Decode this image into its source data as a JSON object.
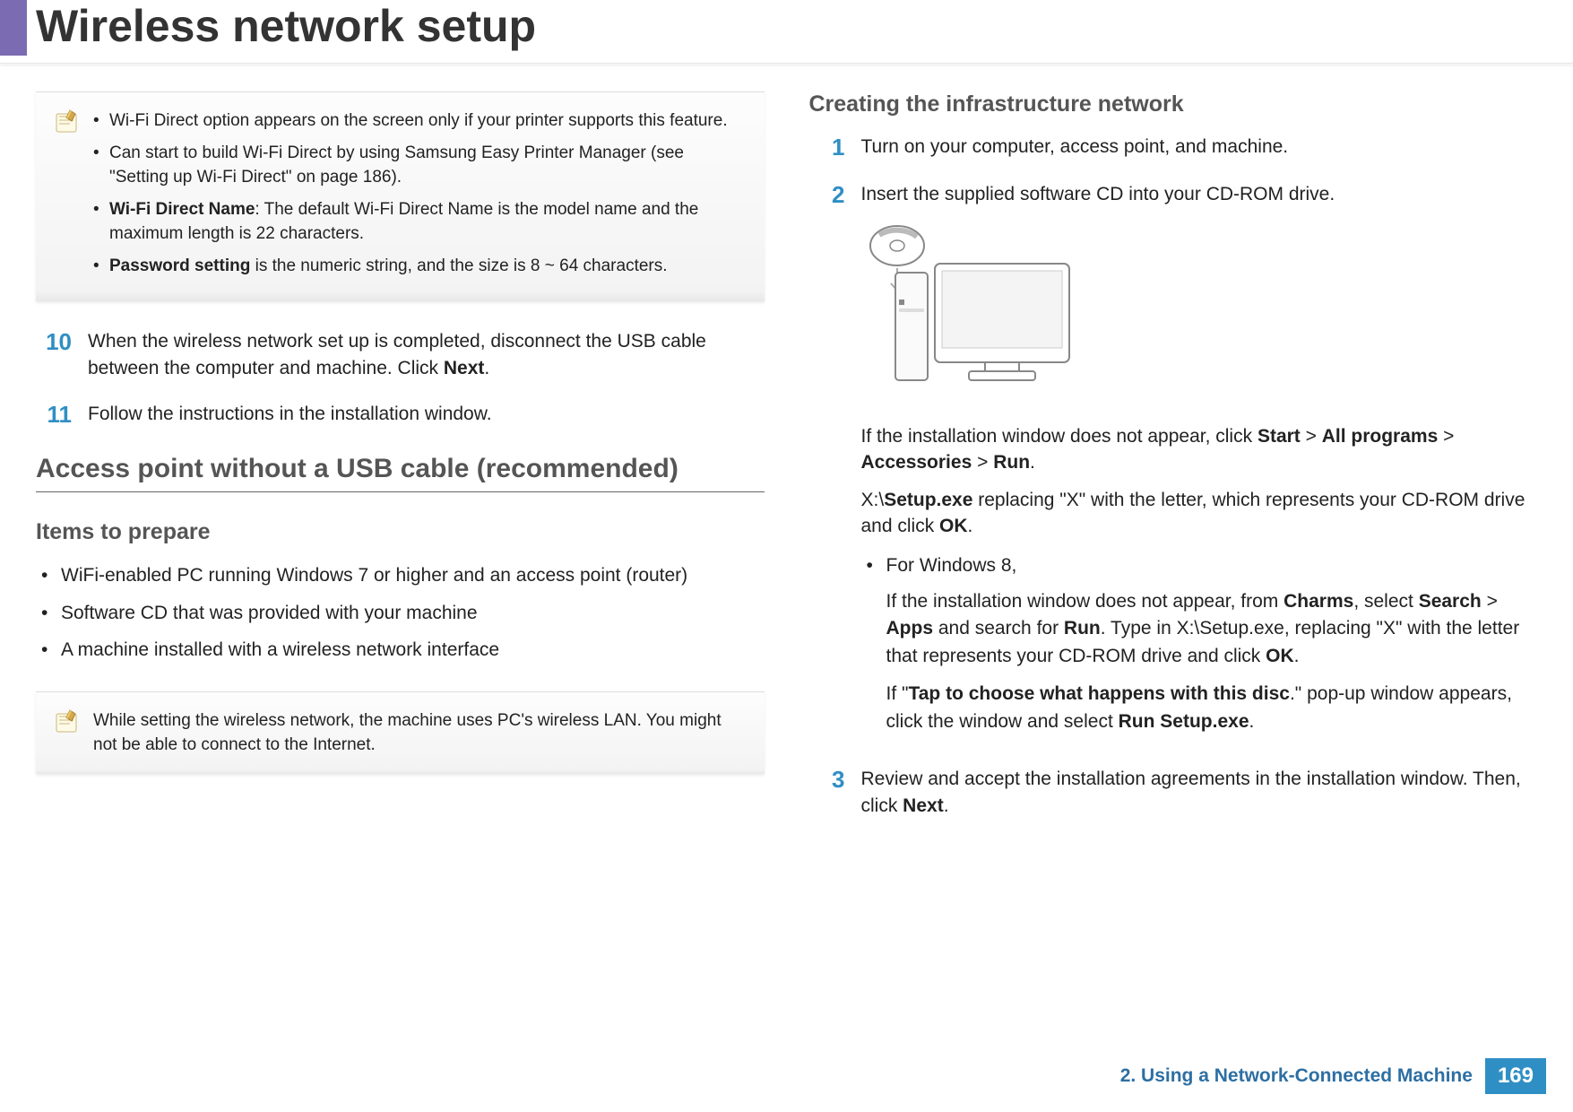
{
  "header": {
    "title": "Wireless network setup"
  },
  "left": {
    "note1": {
      "items": [
        "Wi-Fi Direct option appears on the screen only if your printer supports this feature.",
        "Can start to build Wi-Fi Direct by using Samsung Easy Printer Manager (see \"Setting up Wi-Fi Direct\" on page 186).",
        "<b>Wi-Fi Direct Name</b>: The default Wi-Fi Direct Name is the model name and the maximum length is 22 characters.",
        "<b>Password setting</b> is the numeric string, and the size is 8 ~ 64 characters."
      ]
    },
    "step10": {
      "num": "10",
      "text": "When the wireless network set up is completed, disconnect the USB cable between the computer and machine. Click <b>Next</b>."
    },
    "step11": {
      "num": "11",
      "text": "Follow the instructions in the installation window."
    },
    "h2": "Access point without a USB cable (recommended)",
    "h3": "Items to prepare",
    "prepare": [
      "WiFi-enabled PC running Windows 7 or higher and an access point (router)",
      "Software CD that was provided with your machine",
      "A machine installed with a wireless network interface"
    ],
    "note2": "While setting the wireless network, the machine uses PC's wireless LAN. You might not be able to connect to the Internet."
  },
  "right": {
    "h3": "Creating the infrastructure network",
    "step1": {
      "num": "1",
      "text": "Turn on your computer, access point, and machine."
    },
    "step2": {
      "num": "2",
      "p1": "Insert the supplied software CD into your CD-ROM drive.",
      "p2": "If the installation window does not appear, click <b>Start</b> > <b>All programs</b> > <b>Accessories</b> > <b>Run</b>.",
      "p3": " X:\\<b>Setup.exe</b> replacing \"X\" with the letter, which represents your CD-ROM drive and click <b>OK</b>.",
      "bullet": "For Windows 8,",
      "sub1": "If the installation window does not appear, from <b>Charms</b>, select <b>Search</b> > <b>Apps</b> and search for <b>Run</b>. Type in X:\\Setup.exe, replacing \"X\" with the letter that represents your CD-ROM drive and click <b>OK</b>.",
      "sub2": "If \"<b>Tap to choose what happens with this disc</b>.\" pop-up window appears, click the window and select <b>Run Setup.exe</b>."
    },
    "step3": {
      "num": "3",
      "text": "Review and accept the installation agreements in the installation window. Then, click <b>Next</b>."
    }
  },
  "footer": {
    "chapter": "2.  Using a Network-Connected Machine",
    "page": "169"
  }
}
